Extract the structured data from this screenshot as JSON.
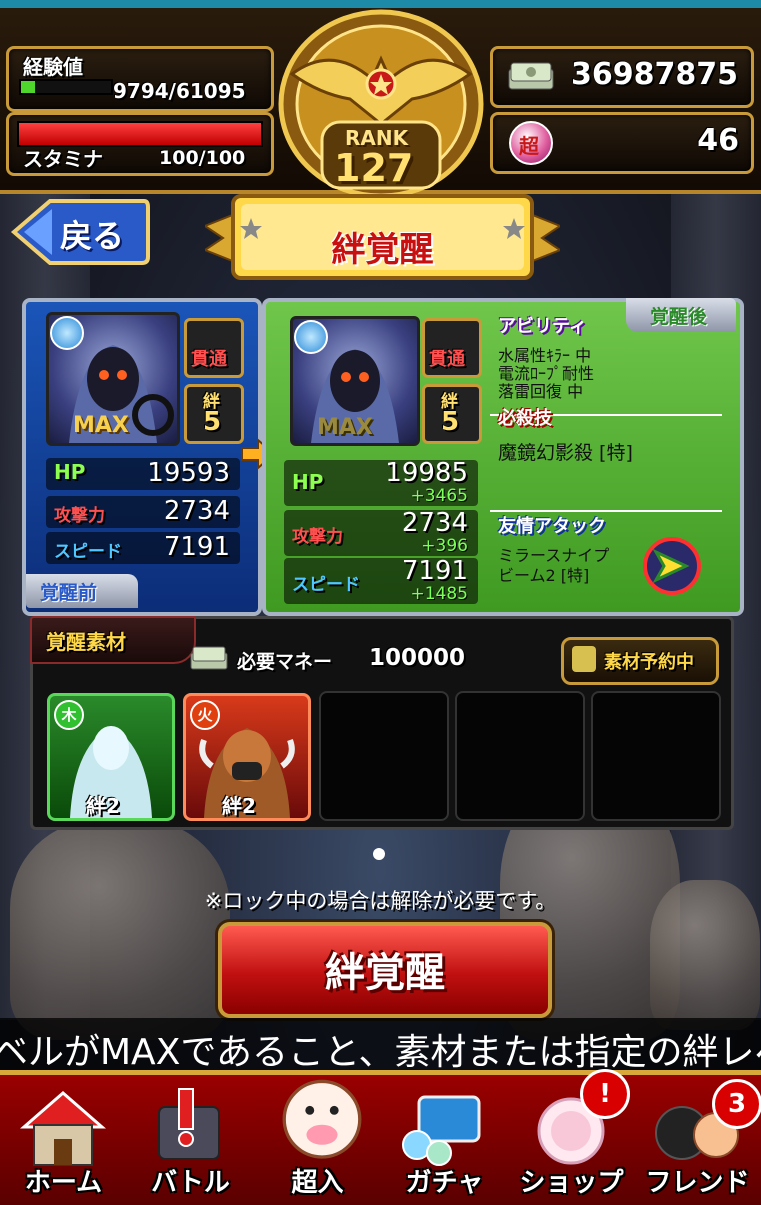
{
  "header": {
    "exp_label": "経験値",
    "exp_value": "9794/61095",
    "exp_fraction": 0.16,
    "stamina_label": "スタミナ",
    "stamina_value": "100/100",
    "stamina_fraction": 1.0,
    "rank_label": "RANK",
    "rank_value": "127",
    "money_value": "36987875",
    "orb_icon_text": "超",
    "orb_value": "46"
  },
  "nav_top": {
    "back_label": "戻る",
    "title": "絆覚醒"
  },
  "before_card": {
    "max_label": "MAX",
    "pierce_label": "貫通",
    "bond_label": "絆",
    "bond_level": "5",
    "hp_label": "HP",
    "hp_value": "19593",
    "atk_label": "攻撃力",
    "atk_value": "2734",
    "spd_label": "スピード",
    "spd_value": "7191",
    "state_label": "覚醒前"
  },
  "after_card": {
    "max_label": "MAX",
    "pierce_label": "貫通",
    "bond_label": "絆",
    "bond_level": "5",
    "hp_label": "HP",
    "hp_value": "19985",
    "hp_plus": "+3465",
    "atk_label": "攻撃力",
    "atk_value": "2734",
    "atk_plus": "+396",
    "spd_label": "スピード",
    "spd_value": "7191",
    "spd_plus": "+1485",
    "state_label": "覚醒後",
    "ability_head": "アビリティ",
    "ability_lines": [
      "水属性ｷﾗｰ 中",
      "電流ﾛｰﾌﾟ耐性",
      "落雷回復 中"
    ],
    "special_head": "必殺技",
    "special_text": "魔鏡幻影殺 [特]",
    "friend_head": "友情アタック",
    "friend_lines": [
      "ミラースナイプ",
      "ビーム2 [特]"
    ]
  },
  "materials": {
    "title": "覚醒素材",
    "money_label": "必要マネー",
    "money_value": "100000",
    "reserve_label": "素材予約中",
    "items": [
      {
        "element": "木",
        "bond": "絆2"
      },
      {
        "element": "火",
        "bond": "絆2"
      }
    ]
  },
  "footer": {
    "note": "※ロック中の場合は解除が必要です。",
    "action_label": "絆覚醒",
    "ticker": "ベルがMAXであること、素材または指定の絆レベ"
  },
  "bottom_nav": [
    {
      "label": "ホーム"
    },
    {
      "label": "バトル"
    },
    {
      "label": "超入"
    },
    {
      "label": "ガチャ"
    },
    {
      "label": "ショップ",
      "badge": "!"
    },
    {
      "label": "フレンド",
      "badge": "3"
    }
  ],
  "colors": {
    "gold": "#c89a3a",
    "exp_green": "#4fd62c",
    "stamina_red": "#e01818",
    "card_blue": "#1a55b8",
    "card_green": "#58b83a"
  }
}
